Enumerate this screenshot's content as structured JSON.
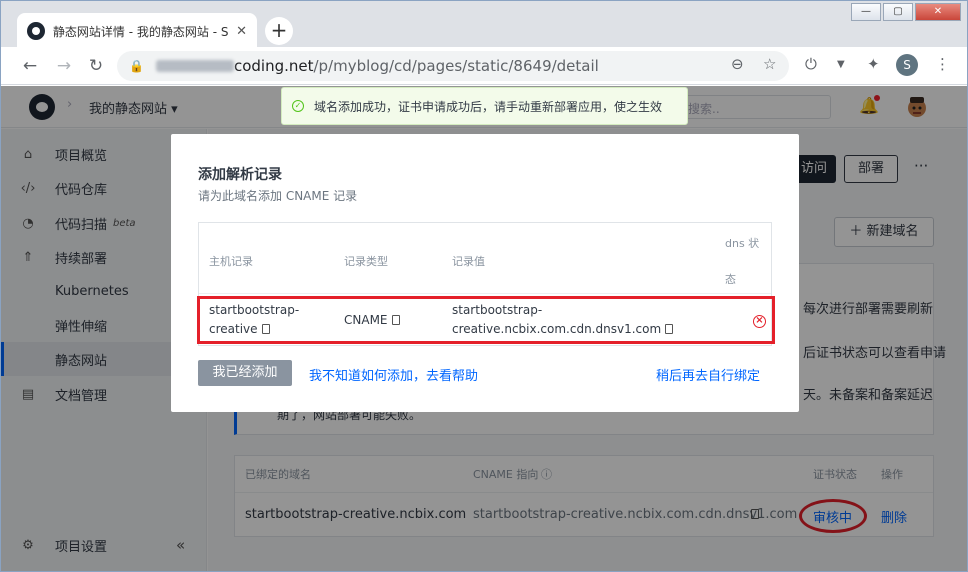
{
  "browser": {
    "tab_title": "静态网站详情 - 我的静态网站 - S",
    "tab_close": "✕",
    "new_tab": "+",
    "url_host": "coding.net",
    "url_path": "/p/myblog/cd/pages/static/8649/detail",
    "profile_initial": "S",
    "window_buttons": [
      "—",
      "▢",
      "✕"
    ]
  },
  "header": {
    "project_name": "我的静态网站 ▾",
    "search_placeholder": "搜索.."
  },
  "toast": {
    "icon": "check-circle-icon",
    "message": "域名添加成功，证书申请成功后，请手动重新部署应用，使之生效"
  },
  "sidebar": {
    "items": [
      {
        "label": "项目概览",
        "icon": "home-icon"
      },
      {
        "label": "代码仓库",
        "icon": "code-icon"
      },
      {
        "label": "代码扫描",
        "icon": "scan-icon",
        "badge": "beta"
      },
      {
        "label": "持续部署",
        "icon": "rocket-icon"
      },
      {
        "label": "Kubernetes"
      },
      {
        "label": "弹性伸缩"
      },
      {
        "label": "静态网站"
      },
      {
        "label": "文档管理",
        "icon": "doc-icon"
      }
    ],
    "settings_label": "项目设置",
    "collapse": "«"
  },
  "main": {
    "visit_button": "访问",
    "deploy_button": "部署",
    "more": "···",
    "new_domain_button": "＋ 新建域名",
    "notice_fragments": [
      "每次进行部署需要刷新",
      "后证书状态可以查看申请",
      "天。未备案和备案延迟",
      "期了，网站部署可能失败。"
    ],
    "domain_table": {
      "headers": [
        "已绑定的域名",
        "CNAME 指向",
        "证书状态",
        "操作"
      ],
      "row": {
        "domain": "startbootstrap-creative.ncbix.com",
        "cname": "startbootstrap-creative.ncbix.com.cdn.dnsv1.com",
        "status": "审核中",
        "action": "删除"
      }
    }
  },
  "modal": {
    "title": "添加解析记录",
    "subtitle": "请为此域名添加 CNAME 记录",
    "headers": [
      "主机记录",
      "记录类型",
      "记录值",
      "dns 状",
      "态"
    ],
    "record": {
      "host_line1": "startbootstrap-",
      "host_line2": "creative",
      "type": "CNAME",
      "value_line1": "startbootstrap-",
      "value_line2": "creative.ncbix.com.cdn.dnsv1.com",
      "dns_status_icon": "error-circle-icon"
    },
    "confirm_button": "我已经添加",
    "help_link": "我不知道如何添加，去看帮助",
    "later_link": "稍后再去自行绑定"
  }
}
